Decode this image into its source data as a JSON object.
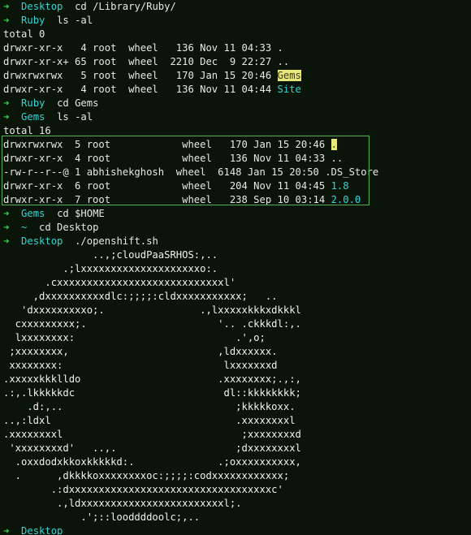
{
  "terminal": {
    "background_color": "#0a1408",
    "foreground_color": "#e8e8e8",
    "prompt_symbol": "➜",
    "prompt_arrow_color": "#35d34b",
    "path_color": "#2ed6d6",
    "selection_border_color": "#54b054",
    "highlight_background_color": "#e8e87a"
  },
  "session": [
    {
      "type": "prompt",
      "cwd": "Desktop",
      "command": "cd /Library/Ruby/"
    },
    {
      "type": "prompt",
      "cwd": "Ruby",
      "command": "ls -al"
    },
    {
      "type": "output",
      "text": "total 0"
    },
    {
      "type": "output",
      "text": "drwxr-xr-x   4 root  wheel   136 Nov 11 04:33 ."
    },
    {
      "type": "output",
      "text": "drwxr-xr-x+ 65 root  wheel  2210 Dec  9 22:27 .."
    },
    {
      "type": "output",
      "text": "drwxrwxrwx   5 root  wheel   170 Jan 15 20:46 ",
      "entry": "Gems",
      "entry_style": "highlight"
    },
    {
      "type": "output",
      "text": "drwxr-xr-x   4 root  wheel   136 Nov 11 04:44 ",
      "entry": "Site",
      "entry_style": "dir"
    },
    {
      "type": "prompt",
      "cwd": "Ruby",
      "command": "cd Gems"
    },
    {
      "type": "prompt",
      "cwd": "Gems",
      "command": "ls -al"
    },
    {
      "type": "output",
      "text": "total 16"
    },
    {
      "type": "output",
      "text": "drwxrwxrwx  5 root            wheel   170 Jan 15 20:46 ",
      "entry": ".",
      "entry_style": "highlight",
      "boxed": true
    },
    {
      "type": "output",
      "text": "drwxr-xr-x  4 root            wheel   136 Nov 11 04:33 ..",
      "boxed": true
    },
    {
      "type": "output",
      "text": "-rw-r--r--@ 1 abhishekghosh  wheel  6148 Jan 15 20:50 .DS_Store",
      "boxed": true
    },
    {
      "type": "output",
      "text": "drwxr-xr-x  6 root            wheel   204 Nov 11 04:45 ",
      "entry": "1.8",
      "entry_style": "dir",
      "boxed": true
    },
    {
      "type": "output",
      "text": "drwxr-xr-x  7 root            wheel   238 Sep 10 03:14 ",
      "entry": "2.0.0",
      "entry_style": "dir",
      "boxed": true
    },
    {
      "type": "prompt",
      "cwd": "Gems",
      "command": "cd $HOME"
    },
    {
      "type": "prompt",
      "cwd": "~",
      "command": "cd Desktop"
    },
    {
      "type": "prompt",
      "cwd": "Desktop",
      "command": "./openshift.sh"
    }
  ],
  "ascii_art": [
    "               ..,;cloudPaaSRHOS:,..",
    "          .;lxxxxxxxxxxxxxxxxxxxxo:.",
    "       .cxxxxxxxxxxxxxxxxxxxxxxxxxxxxl'",
    "     ,dxxxxxxxxxxdlc:;;;;:cldxxxxxxxxxxx;   ..",
    "   'dxxxxxxxxxo;.                .,lxxxxxkkkxdkkkl",
    "  cxxxxxxxxx;.                      '.. .ckkkdl:,.",
    "  lxxxxxxxx:                           .',o;",
    " ;xxxxxxxx,                         ,ldxxxxxx.",
    " xxxxxxxx:                           lxxxxxxxd",
    ".xxxxxkkklldo                       .xxxxxxxx;.,:,",
    ".:,.lkkkkkdc                         dl::kkkkkkkk;",
    "    .d:,..                             ;kkkkkoxx.",
    "..,:ldxl                               .xxxxxxxxl",
    ".xxxxxxxxl                              ;xxxxxxxxd",
    " 'xxxxxxxxd'   ..,.                    ;dxxxxxxxxl",
    "  .oxxdodxkkoxkkkkkd:.              .;oxxxxxxxxxx,",
    "  .      ,dkkkkoxxxxxxxxoc:;;;;:codxxxxxxxxxxxx;",
    "        .:dxxxxxxxxxxxxxxxxxxxxxxxxxxxxxxxxxxc'",
    "         .,ldxxxxxxxxxxxxxxxxxxxxxxxxl;.",
    "             .';::looddddoolc;,.."
  ],
  "final_prompt": {
    "type": "prompt",
    "cwd": "Desktop",
    "command": ""
  }
}
